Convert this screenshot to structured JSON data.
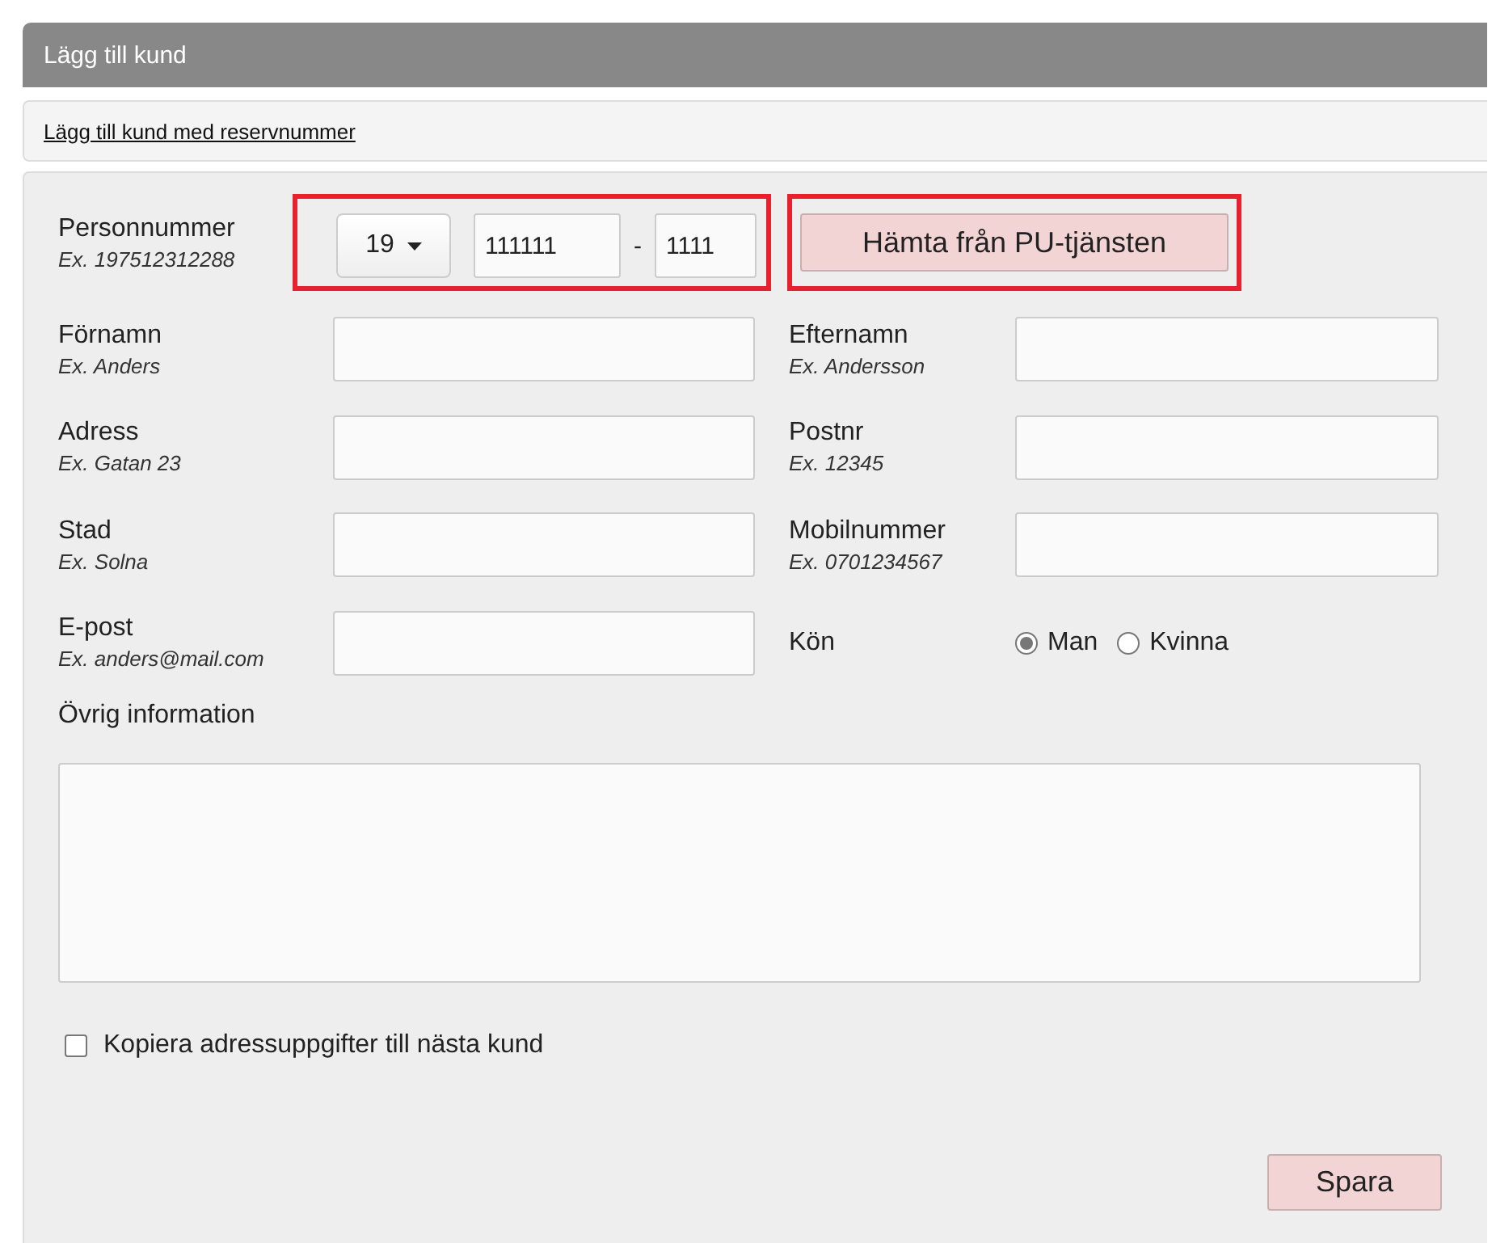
{
  "header": {
    "title": "Lägg till kund"
  },
  "reserve_link": "Lägg till kund med reservnummer",
  "personnummer": {
    "label": "Personnummer",
    "example": "Ex. 197512312288",
    "century": "19",
    "birth": "111111",
    "separator": "-",
    "last": "1111",
    "fetch_button": "Hämta från PU-tjänsten"
  },
  "fields": [
    {
      "kind": "text",
      "label": "Förnamn",
      "example": "Ex. Anders"
    },
    {
      "kind": "text",
      "label": "Efternamn",
      "example": "Ex. Andersson"
    },
    {
      "kind": "text",
      "label": "Adress",
      "example": "Ex. Gatan 23"
    },
    {
      "kind": "text",
      "label": "Postnr",
      "example": "Ex. 12345"
    },
    {
      "kind": "text",
      "label": "Stad",
      "example": "Ex. Solna"
    },
    {
      "kind": "text",
      "label": "Mobilnummer",
      "example": "Ex. 0701234567"
    },
    {
      "kind": "text",
      "label": "E-post",
      "example": "Ex. anders@mail.com"
    },
    {
      "kind": "radio",
      "label": "Kön",
      "options": [
        {
          "label": "Man",
          "selected": true
        },
        {
          "label": "Kvinna",
          "selected": false
        }
      ]
    }
  ],
  "other_info": {
    "label": "Övrig information"
  },
  "copy_checkbox": {
    "label": "Kopiera adressuppgifter till nästa kund",
    "checked": false
  },
  "save_button": "Spara"
}
